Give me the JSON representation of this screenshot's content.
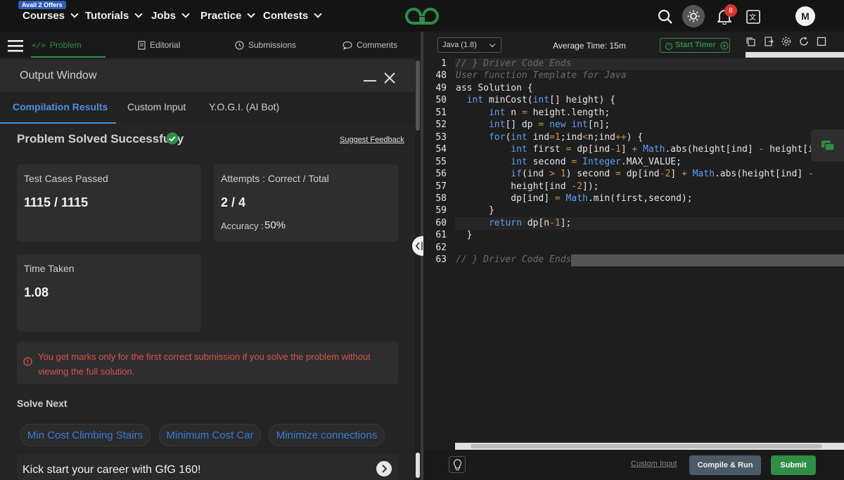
{
  "topnav": {
    "offer_badge": "Avail 2 Offers",
    "items": [
      "Courses",
      "Tutorials",
      "Jobs",
      "Practice",
      "Contests"
    ],
    "notification_count": "8",
    "avatar_initial": "M"
  },
  "left_tabs": [
    "Problem",
    "Editorial",
    "Submissions",
    "Comments"
  ],
  "output_window": {
    "title": "Output Window",
    "subtabs": [
      "Compilation Results",
      "Custom Input",
      "Y.O.G.I. (AI Bot)"
    ],
    "status": "Problem Solved Successfully",
    "feedback_link": "Suggest Feedback",
    "test_cases_label": "Test Cases Passed",
    "test_cases_value": "1115 / 1115",
    "attempts_label": "Attempts : Correct / Total",
    "attempts_value": "2 / 4",
    "accuracy_label": "Accuracy :",
    "accuracy_value": "50%",
    "time_label": "Time Taken",
    "time_value": "1.08",
    "notice": "You get marks only for the first correct submission if you solve the problem without viewing the full solution.",
    "solve_next_label": "Solve Next",
    "solve_next": [
      "Min Cost Climbing Stairs",
      "Minimum Cost Car",
      "Minimize connections"
    ],
    "promo": "Kick start your career with GfG 160!"
  },
  "editor": {
    "language": "Java (1.8)",
    "average_time": "Average Time: 15m",
    "timer_label": "Start Timer",
    "line_numbers": [
      "1",
      "48",
      "49",
      "50",
      "51",
      "52",
      "53",
      "54",
      "55",
      "56",
      "57",
      "58",
      "59",
      "60",
      "61",
      "62",
      "63"
    ],
    "custom_input_link": "Custom Input",
    "compile_label": "Compile & Run",
    "submit_label": "Submit"
  },
  "colors": {
    "accent_green": "#2f8d46",
    "link_blue": "#3a7bd5",
    "error_red": "#d9534f"
  }
}
